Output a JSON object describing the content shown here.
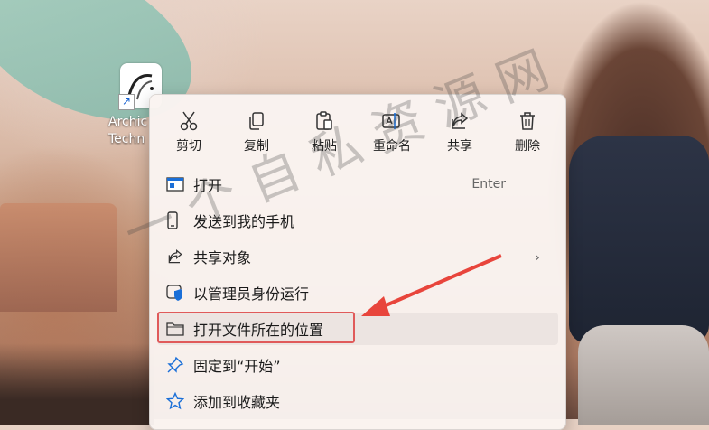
{
  "desktop_icon": {
    "label": "Archic\nTechn",
    "icon": "archicad-icon",
    "overlay": "shortcut-arrow-icon"
  },
  "quick_actions": [
    {
      "label": "剪切",
      "icon": "scissors-icon"
    },
    {
      "label": "复制",
      "icon": "copy-icon"
    },
    {
      "label": "粘贴",
      "icon": "paste-icon"
    },
    {
      "label": "重命名",
      "icon": "rename-icon"
    },
    {
      "label": "共享",
      "icon": "share-icon"
    },
    {
      "label": "删除",
      "icon": "trash-icon"
    }
  ],
  "menu_items": [
    {
      "label": "打开",
      "shortcut": "Enter",
      "icon": "open-app-icon"
    },
    {
      "label": "发送到我的手机",
      "icon": "phone-icon"
    },
    {
      "label": "共享对象",
      "icon": "share-icon",
      "submenu": true
    },
    {
      "label": "以管理员身份运行",
      "icon": "shield-icon"
    },
    {
      "label": "打开文件所在的位置",
      "icon": "folder-icon",
      "highlighted": true
    },
    {
      "label": "固定到“开始”",
      "icon": "pin-icon"
    },
    {
      "label": "添加到收藏夹",
      "icon": "star-icon"
    }
  ],
  "watermark": "一个自私资源网",
  "colors": {
    "menu_bg": "#faf4f1",
    "highlight_box": "#e05a5a",
    "arrow": "#e8453c",
    "shield_blue": "#1a6fd8"
  }
}
